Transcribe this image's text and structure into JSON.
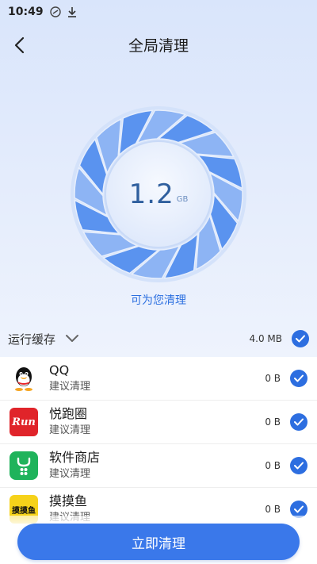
{
  "status_bar": {
    "time": "10:49"
  },
  "header": {
    "title": "全局清理"
  },
  "summary": {
    "size_value": "1.2",
    "size_unit": "GB",
    "subtitle": "可为您清理"
  },
  "cache": {
    "label": "运行缓存",
    "size": "4.0 MB",
    "checked": true
  },
  "apps": [
    {
      "name": "QQ",
      "sub": "建议清理",
      "size": "0 B",
      "icon": "qq-icon"
    },
    {
      "name": "悦跑圈",
      "sub": "建议清理",
      "size": "0 B",
      "icon": "run-icon",
      "icon_text": "Run"
    },
    {
      "name": "软件商店",
      "sub": "建议清理",
      "size": "0 B",
      "icon": "app-store-icon"
    },
    {
      "name": "摸摸鱼",
      "sub": "建议清理",
      "size": "0 B",
      "icon": "momoyu-icon",
      "icon_text": "摸摸鱼"
    }
  ],
  "action": {
    "clean_label": "立即清理"
  },
  "colors": {
    "accent": "#3a78ea",
    "check": "#2d6ee0",
    "subtitle": "#2b6fe0",
    "gauge": "#4a86e8"
  }
}
